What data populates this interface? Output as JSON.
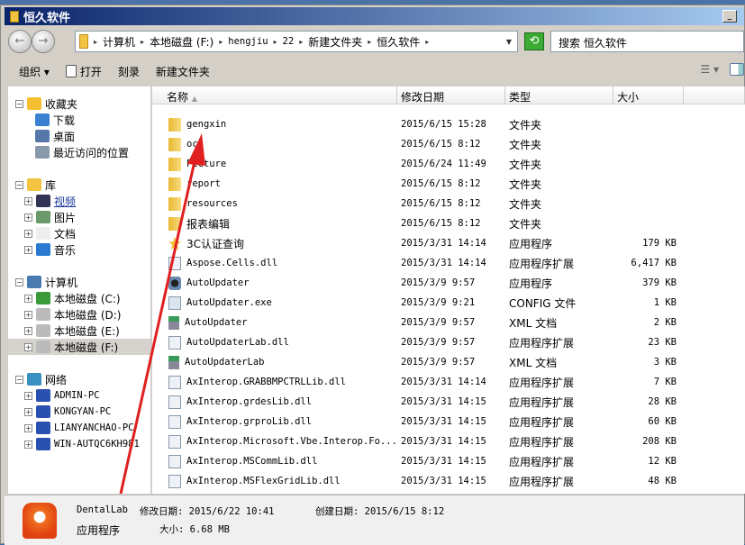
{
  "window": {
    "title": "恒久软件"
  },
  "address": {
    "crumbs": [
      "计算机",
      "本地磁盘 (F:)",
      "hengjiu",
      "22",
      "新建文件夹",
      "恒久软件"
    ]
  },
  "search": {
    "placeholder": "搜索 恒久软件"
  },
  "toolbar": {
    "organize": "组织 ▾",
    "open": "打开",
    "burn": "刻录",
    "new_folder": "新建文件夹"
  },
  "nav": {
    "favorites": {
      "label": "收藏夹",
      "items": [
        "下载",
        "桌面",
        "最近访问的位置"
      ]
    },
    "libraries": {
      "label": "库",
      "items": [
        "视频",
        "图片",
        "文档",
        "音乐"
      ]
    },
    "computer": {
      "label": "计算机",
      "items": [
        "本地磁盘 (C:)",
        "本地磁盘 (D:)",
        "本地磁盘 (E:)",
        "本地磁盘 (F:)"
      ]
    },
    "network": {
      "label": "网络",
      "items": [
        "ADMIN-PC",
        "KONGYAN-PC",
        "LIANYANCHAO-PC",
        "WIN-AUTQC6KH981"
      ]
    }
  },
  "columns": {
    "name": "名称",
    "date": "修改日期",
    "type": "类型",
    "size": "大小"
  },
  "files": [
    {
      "name": "gengxin",
      "date": "2015/6/15 15:28",
      "type": "文件夹",
      "size": "",
      "icon": "folder"
    },
    {
      "name": "ocx",
      "date": "2015/6/15 8:12",
      "type": "文件夹",
      "size": "",
      "icon": "folder"
    },
    {
      "name": "Picture",
      "date": "2015/6/24 11:49",
      "type": "文件夹",
      "size": "",
      "icon": "folder"
    },
    {
      "name": "report",
      "date": "2015/6/15 8:12",
      "type": "文件夹",
      "size": "",
      "icon": "folder"
    },
    {
      "name": "resources",
      "date": "2015/6/15 8:12",
      "type": "文件夹",
      "size": "",
      "icon": "folder"
    },
    {
      "name": "报表编辑",
      "date": "2015/6/15 8:12",
      "type": "文件夹",
      "size": "",
      "icon": "folder"
    },
    {
      "name": "3C认证查询",
      "date": "2015/3/31 14:14",
      "type": "应用程序",
      "size": "179 KB",
      "icon": "app"
    },
    {
      "name": "Aspose.Cells.dll",
      "date": "2015/3/31 14:14",
      "type": "应用程序扩展",
      "size": "6,417 KB",
      "icon": "dll"
    },
    {
      "name": "AutoUpdater",
      "date": "2015/3/9 9:57",
      "type": "应用程序",
      "size": "379 KB",
      "icon": "upd"
    },
    {
      "name": "AutoUpdater.exe",
      "date": "2015/3/9 9:21",
      "type": "CONFIG 文件",
      "size": "1 KB",
      "icon": "cfg"
    },
    {
      "name": "AutoUpdater",
      "date": "2015/3/9 9:57",
      "type": "XML 文档",
      "size": "2 KB",
      "icon": "xml"
    },
    {
      "name": "AutoUpdaterLab.dll",
      "date": "2015/3/9 9:57",
      "type": "应用程序扩展",
      "size": "23 KB",
      "icon": "dll"
    },
    {
      "name": "AutoUpdaterLab",
      "date": "2015/3/9 9:57",
      "type": "XML 文档",
      "size": "3 KB",
      "icon": "xml"
    },
    {
      "name": "AxInterop.GRABBMPCTRLLib.dll",
      "date": "2015/3/31 14:14",
      "type": "应用程序扩展",
      "size": "7 KB",
      "icon": "dll"
    },
    {
      "name": "AxInterop.grdesLib.dll",
      "date": "2015/3/31 14:15",
      "type": "应用程序扩展",
      "size": "28 KB",
      "icon": "dll"
    },
    {
      "name": "AxInterop.grproLib.dll",
      "date": "2015/3/31 14:15",
      "type": "应用程序扩展",
      "size": "60 KB",
      "icon": "dll"
    },
    {
      "name": "AxInterop.Microsoft.Vbe.Interop.Fo...",
      "date": "2015/3/31 14:15",
      "type": "应用程序扩展",
      "size": "208 KB",
      "icon": "dll"
    },
    {
      "name": "AxInterop.MSCommLib.dll",
      "date": "2015/3/31 14:15",
      "type": "应用程序扩展",
      "size": "12 KB",
      "icon": "dll"
    },
    {
      "name": "AxInterop.MSFlexGridLib.dll",
      "date": "2015/3/31 14:15",
      "type": "应用程序扩展",
      "size": "48 KB",
      "icon": "dll"
    }
  ],
  "details": {
    "name": "DentalLab",
    "modified": "修改日期: 2015/6/22 10:41",
    "created": "创建日期: 2015/6/15 8:12",
    "type": "应用程序",
    "size": "大小: 6.68 MB"
  }
}
